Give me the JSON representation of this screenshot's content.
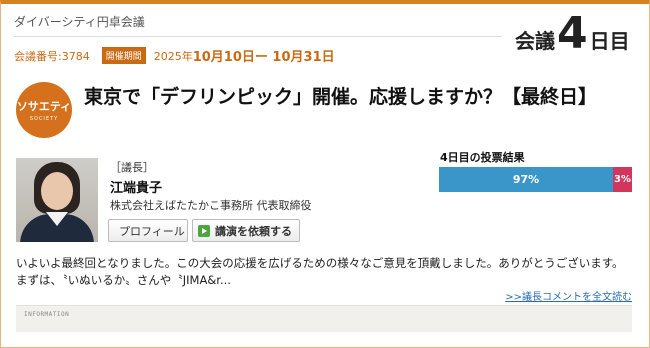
{
  "header": {
    "site_name": "ダイバーシティ円卓会議",
    "meeting_number": "会議番号:3784",
    "period_badge": "開催期間",
    "year": "2025年",
    "dates": "10月10日ー 10月31日",
    "day_prefix": "会議",
    "day_number": "4",
    "day_suffix": "日目"
  },
  "logo": {
    "text": "ソサエティ",
    "subtext": "SOCIETY",
    "color": "#d5711c"
  },
  "title": "東京で「デフリンピック」開催。応援しますか？【最終日】",
  "chair": {
    "role": "［議長］",
    "name": "江端貴子",
    "company": "株式会社えばたたかこ事務所 代表取締役",
    "profile_button": "プロフィール",
    "request_button": "講演を依頼する"
  },
  "vote": {
    "title": "4日目の投票結果",
    "yes_percent": 97,
    "yes_label": "97%",
    "no_percent": 3,
    "no_label": "3%",
    "yes_color": "#3a95c8",
    "no_color": "#d2365c"
  },
  "message": "いよいよ最終回となりました。この大会の応援を広げるための様々なご意見を頂戴しました。ありがとうございます。　まずは、〝いぬいるか〟さんや〝JIMA&r...",
  "read_more": ">>議長コメントを全文読む",
  "info_label": "INFORMATION"
}
